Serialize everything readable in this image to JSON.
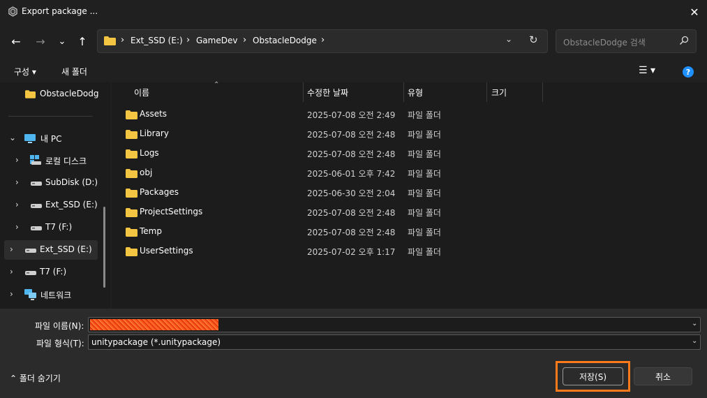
{
  "window": {
    "title": "Export package ...",
    "close_glyph": "✕"
  },
  "nav": {
    "back_glyph": "←",
    "forward_glyph": "→",
    "recent_glyph": "⌄",
    "up_glyph": "↑",
    "breadcrumbs": [
      "Ext_SSD (E:)",
      "GameDev",
      "ObstacleDodge"
    ],
    "separator": "›",
    "dropdown_glyph": "⌄",
    "refresh_glyph": "↻"
  },
  "search": {
    "placeholder": "ObstacleDodge 검색"
  },
  "commandbar": {
    "organize_label": "구성 ▾",
    "new_folder_label": "새 폴더",
    "view_glyph": "☰ ▾",
    "help_glyph": "?"
  },
  "sidebar": {
    "items": [
      {
        "label": "ObstacleDodg",
        "icon": "folder-icon",
        "chevron": ""
      },
      {
        "label": "내 PC",
        "icon": "pc-icon",
        "chevron": "⌄"
      },
      {
        "label": "로컬 디스크",
        "icon": "local-disk-icon",
        "chevron": "›"
      },
      {
        "label": "SubDisk (D:)",
        "icon": "drive-icon",
        "chevron": "›"
      },
      {
        "label": "Ext_SSD (E:)",
        "icon": "drive-icon",
        "chevron": "›"
      },
      {
        "label": "T7 (F:)",
        "icon": "drive-icon",
        "chevron": "›"
      },
      {
        "label": "Ext_SSD (E:)",
        "icon": "drive-icon",
        "chevron": "›"
      },
      {
        "label": "T7 (F:)",
        "icon": "drive-icon",
        "chevron": "›"
      },
      {
        "label": "네트워크",
        "icon": "network-icon",
        "chevron": "›"
      }
    ]
  },
  "columns": {
    "name": "이름",
    "date": "수정한 날짜",
    "type": "유형",
    "size": "크기",
    "sort_glyph": "⌃"
  },
  "files": [
    {
      "name": "Assets",
      "date": "2025-07-08 오전 2:49",
      "type": "파일 폴더"
    },
    {
      "name": "Library",
      "date": "2025-07-08 오전 2:48",
      "type": "파일 폴더"
    },
    {
      "name": "Logs",
      "date": "2025-07-08 오전 2:48",
      "type": "파일 폴더"
    },
    {
      "name": "obj",
      "date": "2025-06-01 오후 7:42",
      "type": "파일 폴더"
    },
    {
      "name": "Packages",
      "date": "2025-06-30 오전 2:04",
      "type": "파일 폴더"
    },
    {
      "name": "ProjectSettings",
      "date": "2025-07-08 오전 2:48",
      "type": "파일 폴더"
    },
    {
      "name": "Temp",
      "date": "2025-07-08 오전 2:48",
      "type": "파일 폴더"
    },
    {
      "name": "UserSettings",
      "date": "2025-07-02 오후 1:17",
      "type": "파일 폴더"
    }
  ],
  "footer": {
    "filename_label": "파일 이름(N):",
    "filetype_label": "파일 형식(T):",
    "filetype_value": "unitypackage (*.unitypackage)",
    "dropdown_glyph": "⌄",
    "hide_folders_label": "⌃  폴더 숨기기",
    "save_label": "저장(S)",
    "cancel_label": "취소"
  },
  "colors": {
    "background": "#202020",
    "panel": "#1c1c1c",
    "footer": "#2b2b2b",
    "folder": "#f4c542",
    "highlight": "#ff7a1a",
    "help": "#1e90ff"
  }
}
